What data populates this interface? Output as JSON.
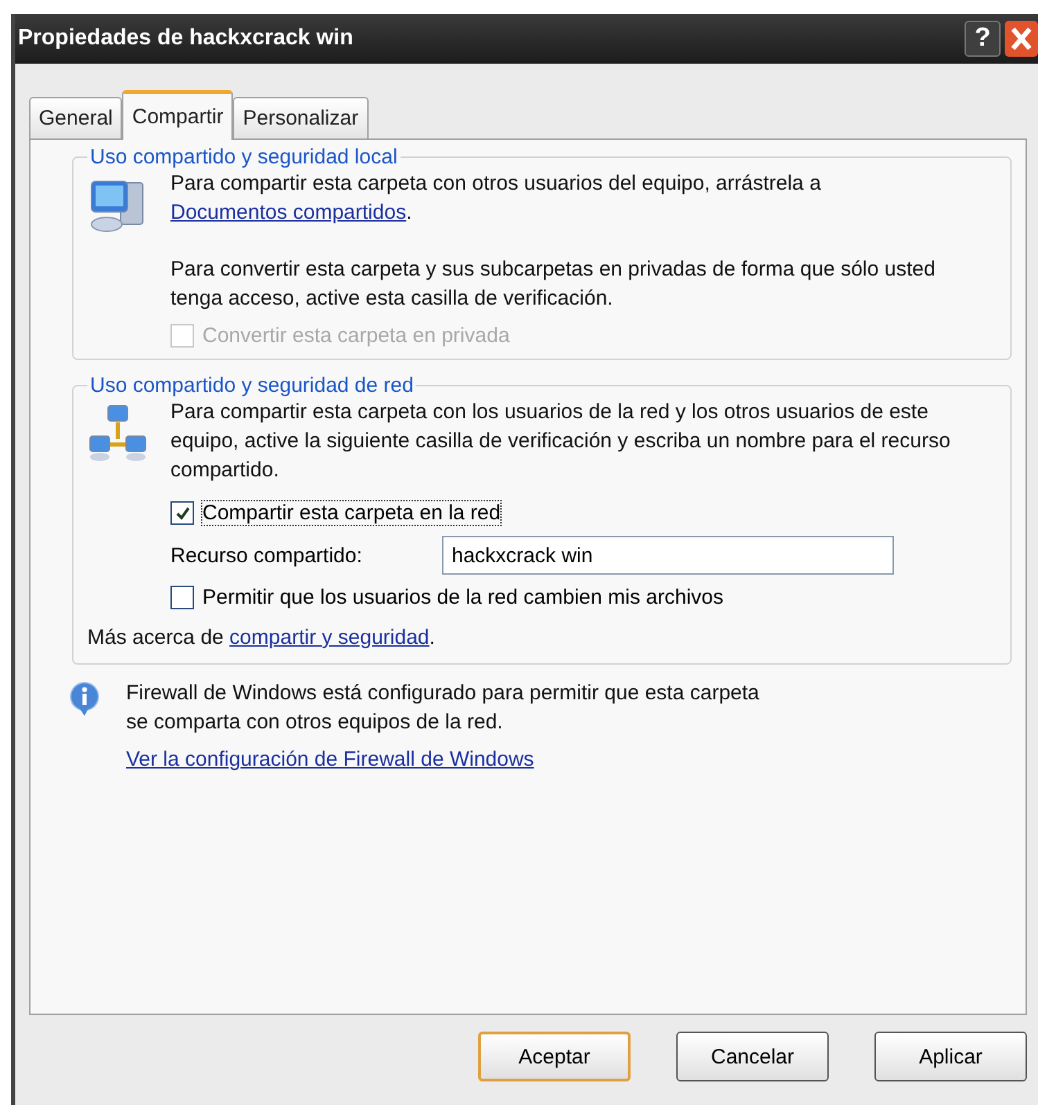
{
  "window": {
    "title": "Propiedades de hackxcrack win",
    "help_button": "?"
  },
  "tabs": [
    {
      "label": "General",
      "selected": false
    },
    {
      "label": "Compartir",
      "selected": true
    },
    {
      "label": "Personalizar",
      "selected": false
    }
  ],
  "local_group": {
    "title": "Uso compartido y seguridad local",
    "text": {
      "before": "Para compartir esta carpeta con otros usuarios del equipo, arrástrela a ",
      "link": "Documentos compartidos",
      "after": "."
    },
    "note": "Para convertir esta carpeta y sus subcarpetas en privadas de forma que sólo usted tenga acceso, active esta casilla de verificación.",
    "checkbox": {
      "label": "Convertir esta carpeta en privada",
      "checked": false,
      "disabled": true
    }
  },
  "network_group": {
    "title": "Uso compartido y seguridad de red",
    "text": "Para compartir esta carpeta con los usuarios de la red y los otros usuarios de este equipo, active la siguiente casilla de verificación y escriba un nombre para el recurso compartido.",
    "share_checkbox": {
      "label": "Compartir esta carpeta en la red",
      "checked": true,
      "disabled": false
    },
    "share_name": {
      "label": "Recurso compartido:",
      "value": "hackxcrack win"
    },
    "permit_checkbox": {
      "label": "Permitir que los usuarios de la red cambien mis archivos",
      "checked": false,
      "disabled": false
    },
    "more": {
      "before": "Más acerca de ",
      "link": "compartir y seguridad",
      "after": "."
    }
  },
  "firewall": {
    "text": "Firewall de Windows está configurado para permitir que esta carpeta se comparta con otros equipos de la red.",
    "link": "Ver la configuración de Firewall de Windows"
  },
  "buttons": [
    {
      "label": "Aceptar",
      "default": true
    },
    {
      "label": "Cancelar",
      "default": false
    },
    {
      "label": "Aplicar",
      "default": false
    }
  ]
}
